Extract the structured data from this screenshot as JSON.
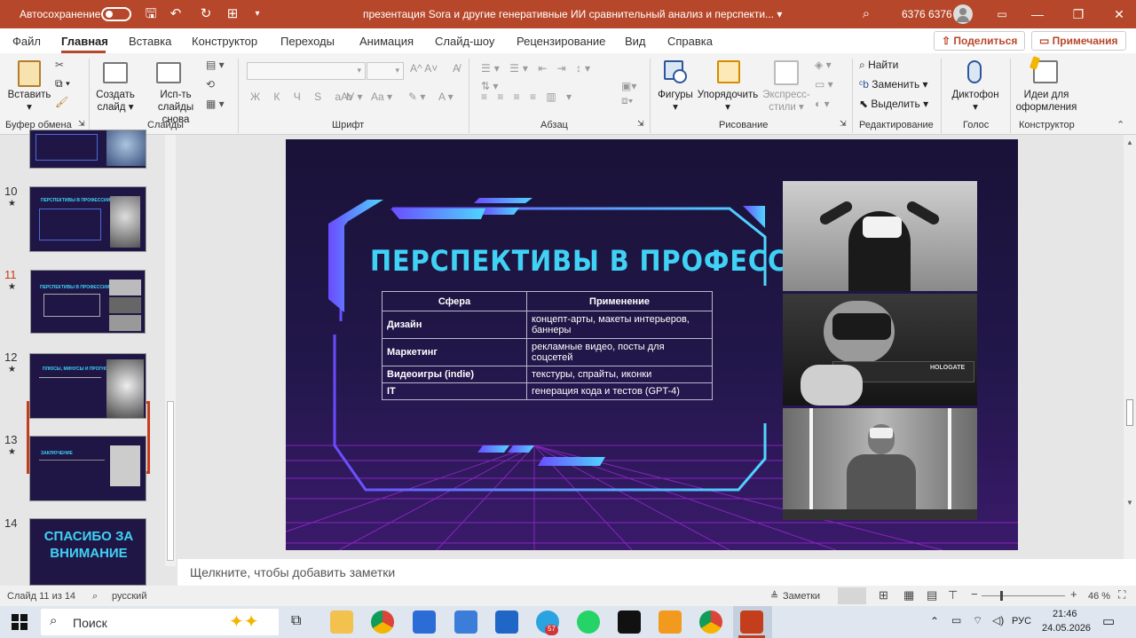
{
  "titlebar": {
    "autosave_label": "Автосохранение",
    "doc_title": "презентация Sora и другие генеративные ИИ сравнительный анализ и перспекти... ▾",
    "user_name": "6376 6376",
    "colors": {
      "accent": "#b7472a"
    }
  },
  "menu": {
    "items": [
      "Файл",
      "Главная",
      "Вставка",
      "Конструктор",
      "Переходы",
      "Анимация",
      "Слайд-шоу",
      "Рецензирование",
      "Вид",
      "Справка"
    ],
    "share_label": "Поделиться",
    "comments_label": "Примечания"
  },
  "ribbon": {
    "paste_label": "Вставить",
    "new_slide_label": "Создать слайд ▾",
    "reuse_label": "Исп-ть слайды снова",
    "shapes_label": "Фигуры",
    "arrange_label": "Упорядочить",
    "styles_label": "Экспресс-стили ▾",
    "find_label": "Найти",
    "replace_label": "Заменить ▾",
    "select_label": "Выделить ▾",
    "dictate_label": "Диктофон",
    "designer_label": "Идеи для оформления",
    "groups": [
      "Буфер обмена",
      "Слайды",
      "Шрифт",
      "Абзац",
      "Рисование",
      "Редактирование",
      "Голос",
      "Конструктор"
    ]
  },
  "thumbnails": {
    "numbers": [
      "10",
      "11",
      "12",
      "13",
      "14"
    ],
    "star": "★",
    "titles": [
      "ПЕРСПЕКТИВЫ В ПРОФЕССИИ",
      "ПЕРСПЕКТИВЫ В ПРОФЕССИИ",
      "ПЛЮСЫ, МИНУСЫ И ПРОГНОЗЫ",
      "ЗАКЛЮЧЕНИЕ",
      "СПАСИБО ЗА ВНИМАНИЕ"
    ]
  },
  "slide": {
    "title": "ПЕРСПЕКТИВЫ В ПРОФЕССИИ",
    "table": {
      "headers": [
        "Сфера",
        "Применение"
      ],
      "rows": [
        [
          "Дизайн",
          "концепт-арты, макеты интерьеров, баннеры"
        ],
        [
          "Маркетинг",
          "рекламные видео, посты для соцсетей"
        ],
        [
          "Видеоигры (indie)",
          "текстуры, спрайты, иконки"
        ],
        [
          "IT",
          "генерация кода и тестов (GPT-4)"
        ]
      ]
    },
    "photo2_text": "HOLOGATE"
  },
  "notes": {
    "placeholder": "Щелкните, чтобы добавить заметки"
  },
  "status": {
    "slide_counter": "Слайд 11 из 14",
    "language": "русский",
    "notes_button": "Заметки",
    "zoom": "46 %"
  },
  "taskbar": {
    "search_placeholder": "Поиск",
    "language": "РУС",
    "time": "21:46",
    "date": "24.05.2026",
    "telegram_badge": "57"
  }
}
